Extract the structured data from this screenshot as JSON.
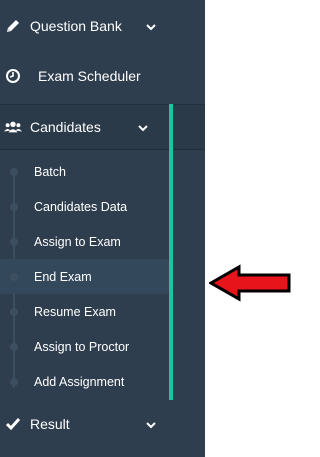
{
  "sidebar": {
    "items": [
      {
        "label": "Question Bank",
        "icon": "pencil-icon"
      },
      {
        "label": "Exam Scheduler",
        "icon": "clock-icon"
      },
      {
        "label": "Candidates",
        "icon": "users-icon"
      },
      {
        "label": "Result",
        "icon": "check-icon"
      }
    ],
    "candidates_submenu": [
      {
        "label": "Batch"
      },
      {
        "label": "Candidates Data"
      },
      {
        "label": "Assign to Exam"
      },
      {
        "label": "End Exam",
        "active": true
      },
      {
        "label": "Resume Exam"
      },
      {
        "label": "Assign to Proctor"
      },
      {
        "label": "Add Assignment"
      }
    ]
  },
  "annotation": {
    "icon": "red-arrow-left-icon",
    "color": "#e8141b"
  },
  "colors": {
    "sidebar_bg": "#2e3e4e",
    "accent": "#1fc39f",
    "active_bg": "#34485b"
  }
}
